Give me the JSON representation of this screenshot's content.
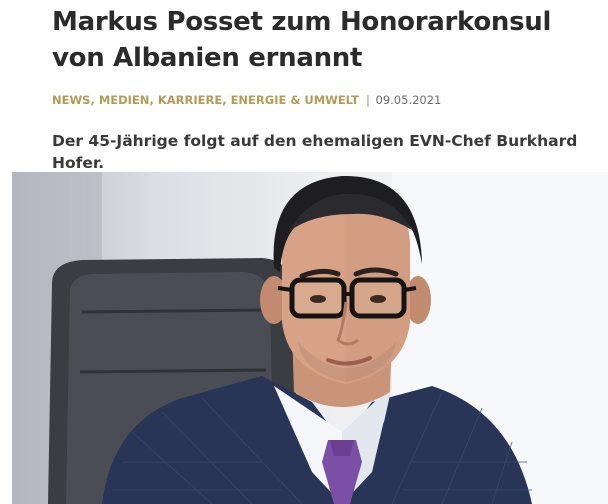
{
  "article": {
    "title": "Markus Posset zum Honorarkonsul von Albanien ernannt",
    "categories": [
      "NEWS",
      "MEDIEN",
      "KARRIERE",
      "ENERGIE & UMWELT"
    ],
    "separator": "|",
    "date": "09.05.2021",
    "teaser": "Der 45-Jährige folgt auf den ehemaligen EVN-Chef Burkhard Hofer."
  },
  "photo": {
    "subject": "portrait of a man in suit with glasses",
    "icon": "portrait-photo"
  },
  "colors": {
    "title": "#2b2b2b",
    "category_accent": "#b49b55",
    "date": "#6e6e6e",
    "teaser": "#3a3a3a"
  }
}
